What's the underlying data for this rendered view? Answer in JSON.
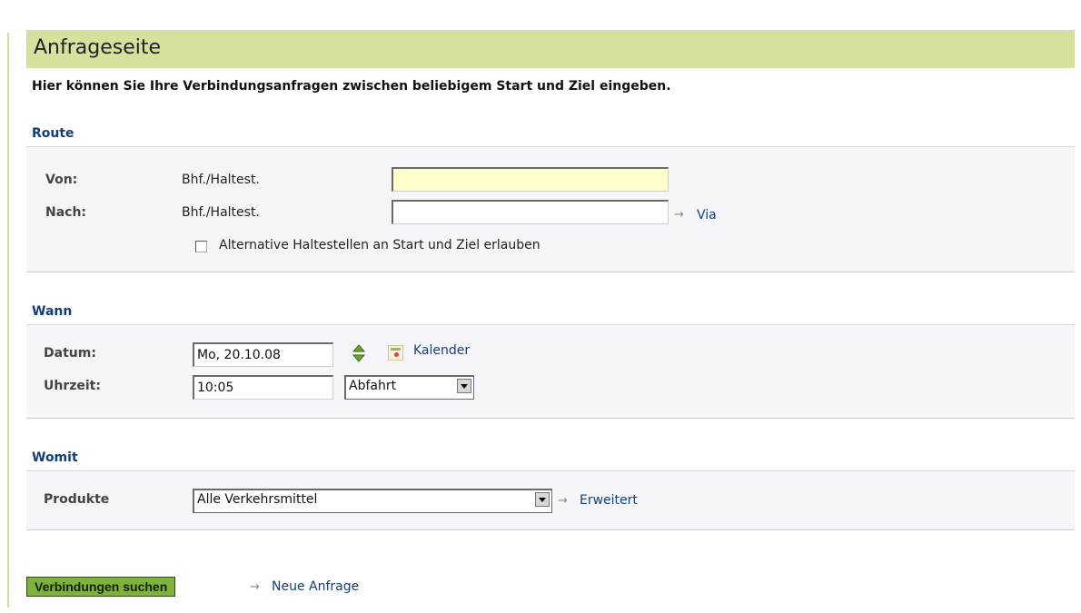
{
  "page": {
    "title": "Anfrageseite",
    "intro": "Hier können Sie Ihre Verbindungsanfragen zwischen beliebigem Start und Ziel eingeben."
  },
  "route": {
    "heading": "Route",
    "from_label": "Von:",
    "from_type": "Bhf./Haltest.",
    "from_value": "",
    "to_label": "Nach:",
    "to_type": "Bhf./Haltest.",
    "to_value": "",
    "via_arrow": "→",
    "via_link": "Via",
    "alt_stops_label": "Alternative Haltestellen an Start und Ziel erlauben",
    "alt_stops_checked": false
  },
  "when": {
    "heading": "Wann",
    "date_label": "Datum:",
    "date_value": "Mo, 20.10.08",
    "calendar_link": "Kalender",
    "time_label": "Uhrzeit:",
    "time_value": "10:05",
    "mode_value": "Abfahrt"
  },
  "with": {
    "heading": "Womit",
    "products_label": "Produkte",
    "products_value": "Alle Verkehrsmittel",
    "advanced_arrow": "→",
    "advanced_link": "Erweitert"
  },
  "actions": {
    "search_button": "Verbindungen suchen",
    "new_request_arrow": "→",
    "new_request_link": "Neue Anfrage"
  },
  "colors": {
    "title_bar": "#d5e29e",
    "link": "#123f7a",
    "heading": "#123f7a",
    "submit_button": "#7eb23a",
    "from_field": "#ffffcc"
  },
  "icons": [
    "updown-arrows-icon",
    "calendar-icon",
    "dropdown-arrow-icon",
    "arrow-right-icon"
  ]
}
